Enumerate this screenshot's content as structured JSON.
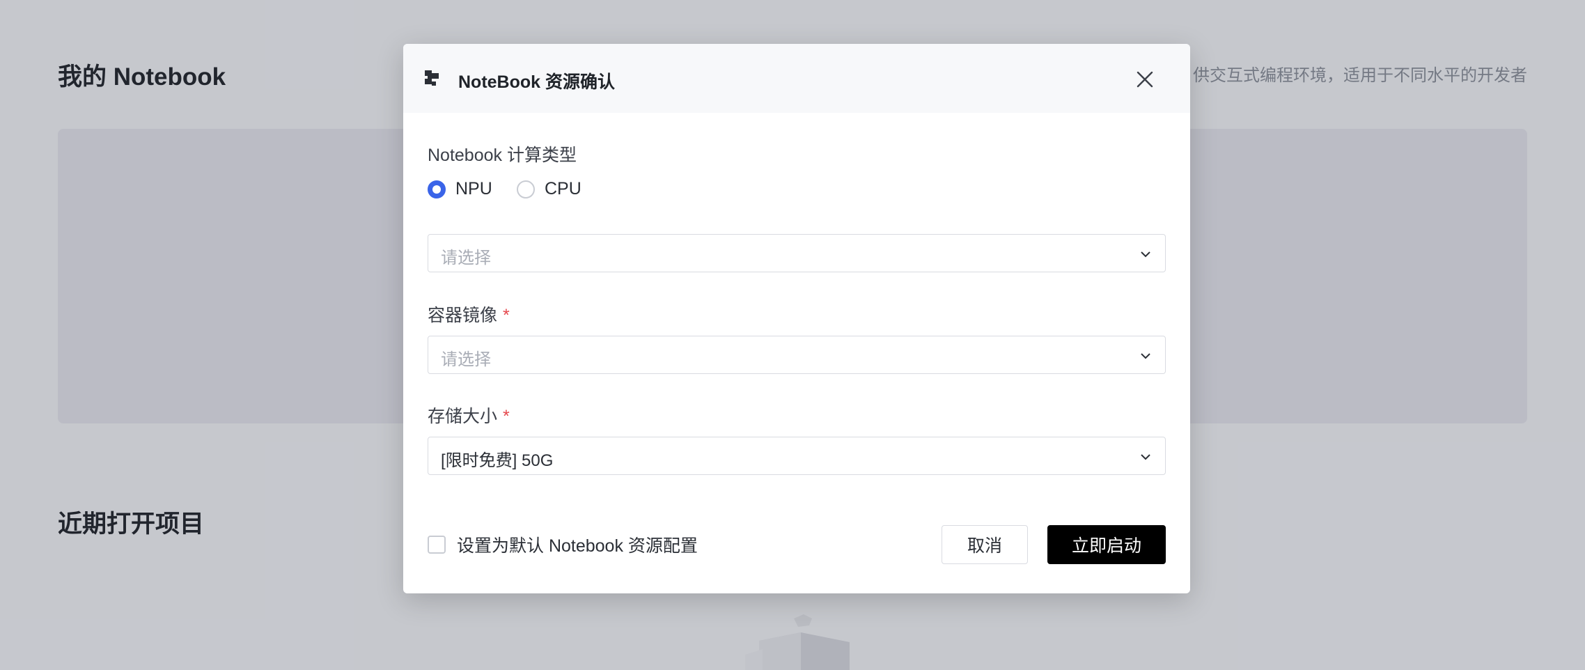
{
  "page": {
    "title": "我的 Notebook",
    "subtitle": "供交互式编程环境，适用于不同水平的开发者",
    "recent_title": "近期打开项目"
  },
  "modal": {
    "title": "NoteBook 资源确认",
    "compute_type": {
      "label": "Notebook 计算类型",
      "options": [
        "NPU",
        "CPU"
      ],
      "selected": "NPU"
    },
    "spec_select": {
      "placeholder": "请选择"
    },
    "image": {
      "label": "容器镜像",
      "required_mark": "*",
      "placeholder": "请选择"
    },
    "storage": {
      "label": "存储大小",
      "required_mark": "*",
      "value": "[限时免费] 50G"
    },
    "default_checkbox": {
      "label": "设置为默认 Notebook 资源配置",
      "checked": false
    },
    "buttons": {
      "cancel": "取消",
      "confirm": "立即启动"
    }
  },
  "colors": {
    "accent": "#3a64e8",
    "primary_button": "#000000",
    "required": "#e5484d"
  },
  "icons": {
    "logo": "notebook-logo-icon",
    "close": "close-icon",
    "chevron": "chevron-down-icon"
  }
}
